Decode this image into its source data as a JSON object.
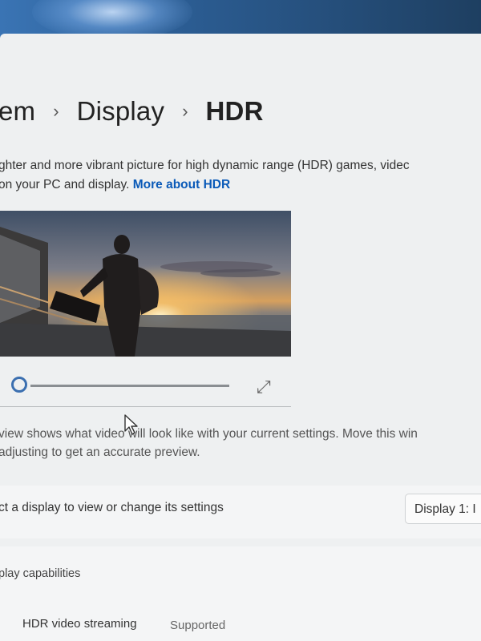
{
  "breadcrumb": {
    "items": [
      {
        "label": "em"
      },
      {
        "label": "Display"
      },
      {
        "label": "HDR"
      }
    ],
    "separator": "›"
  },
  "description": {
    "line1": "ghter and more vibrant picture for high dynamic range (HDR) games, videc",
    "line2": "on your PC and display.",
    "link_text": "More about HDR"
  },
  "preview": {
    "slider_value": 0.0
  },
  "hint": {
    "line1": "view shows what video will look like with your current settings. Move this win",
    "line2": "adjusting to get an accurate preview."
  },
  "display_select": {
    "label": "ct a display to view or change its settings",
    "selected": "Display 1: I"
  },
  "capabilities": {
    "title": "play capabilities",
    "rows": [
      {
        "label": "HDR video streaming",
        "value": "Supported"
      }
    ]
  },
  "colors": {
    "accent": "#3b6fb0",
    "link": "#0a5ab8",
    "window_bg": "#eef0f1"
  }
}
